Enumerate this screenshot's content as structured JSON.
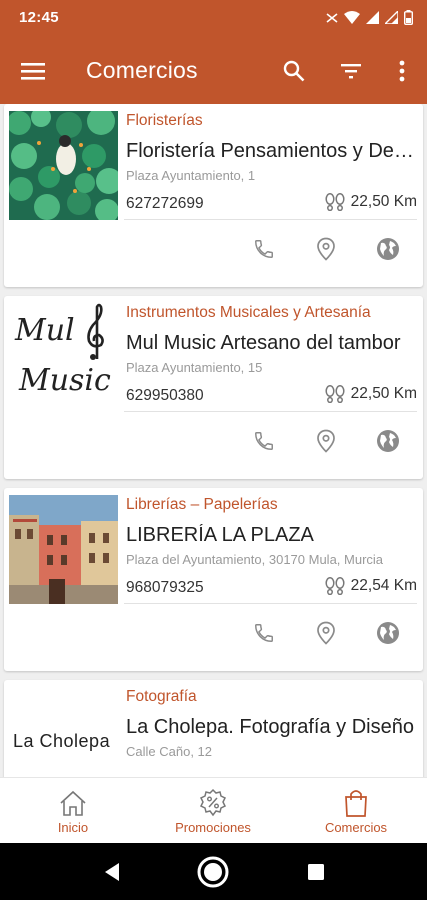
{
  "status_bar": {
    "time": "12:45"
  },
  "app_bar": {
    "title": "Comercios",
    "icons": [
      "menu-icon",
      "search-icon",
      "filter-icon",
      "more-vert-icon"
    ]
  },
  "listings": [
    {
      "category": "Floristerías",
      "name": "Floristería Pensamientos y Detalles",
      "address": "Plaza Ayuntamiento, 1",
      "phone": "627272699",
      "distance": "22,50 Km"
    },
    {
      "category": "Instrumentos Musicales y Artesanía",
      "name": "Mul Music Artesano del tambor",
      "address": "Plaza Ayuntamiento, 15",
      "phone": "629950380",
      "distance": "22,50 Km",
      "logo_line1": "Mul",
      "logo_line2": "Music"
    },
    {
      "category": "Librerías – Papelerías",
      "name": "LIBRERÍA LA PLAZA",
      "address": "Plaza del Ayuntamiento, 30170 Mula, Murcia",
      "phone": "968079325",
      "distance": "22,54 Km"
    },
    {
      "category": "Fotografía",
      "name": "La Cholepa. Fotografía y Diseño",
      "address": "Calle Caño, 12",
      "phone": "",
      "distance": "",
      "logo_text": "La Cholepa"
    }
  ],
  "bottom_nav": {
    "items": [
      {
        "label": "Inicio",
        "icon": "home-icon"
      },
      {
        "label": "Promociones",
        "icon": "promotion-badge-icon"
      },
      {
        "label": "Comercios",
        "icon": "shopping-bag-icon",
        "active": true
      }
    ]
  },
  "colors": {
    "primary": "#c0552c",
    "background": "#efefef",
    "icon_gray": "#8a8a8a"
  }
}
